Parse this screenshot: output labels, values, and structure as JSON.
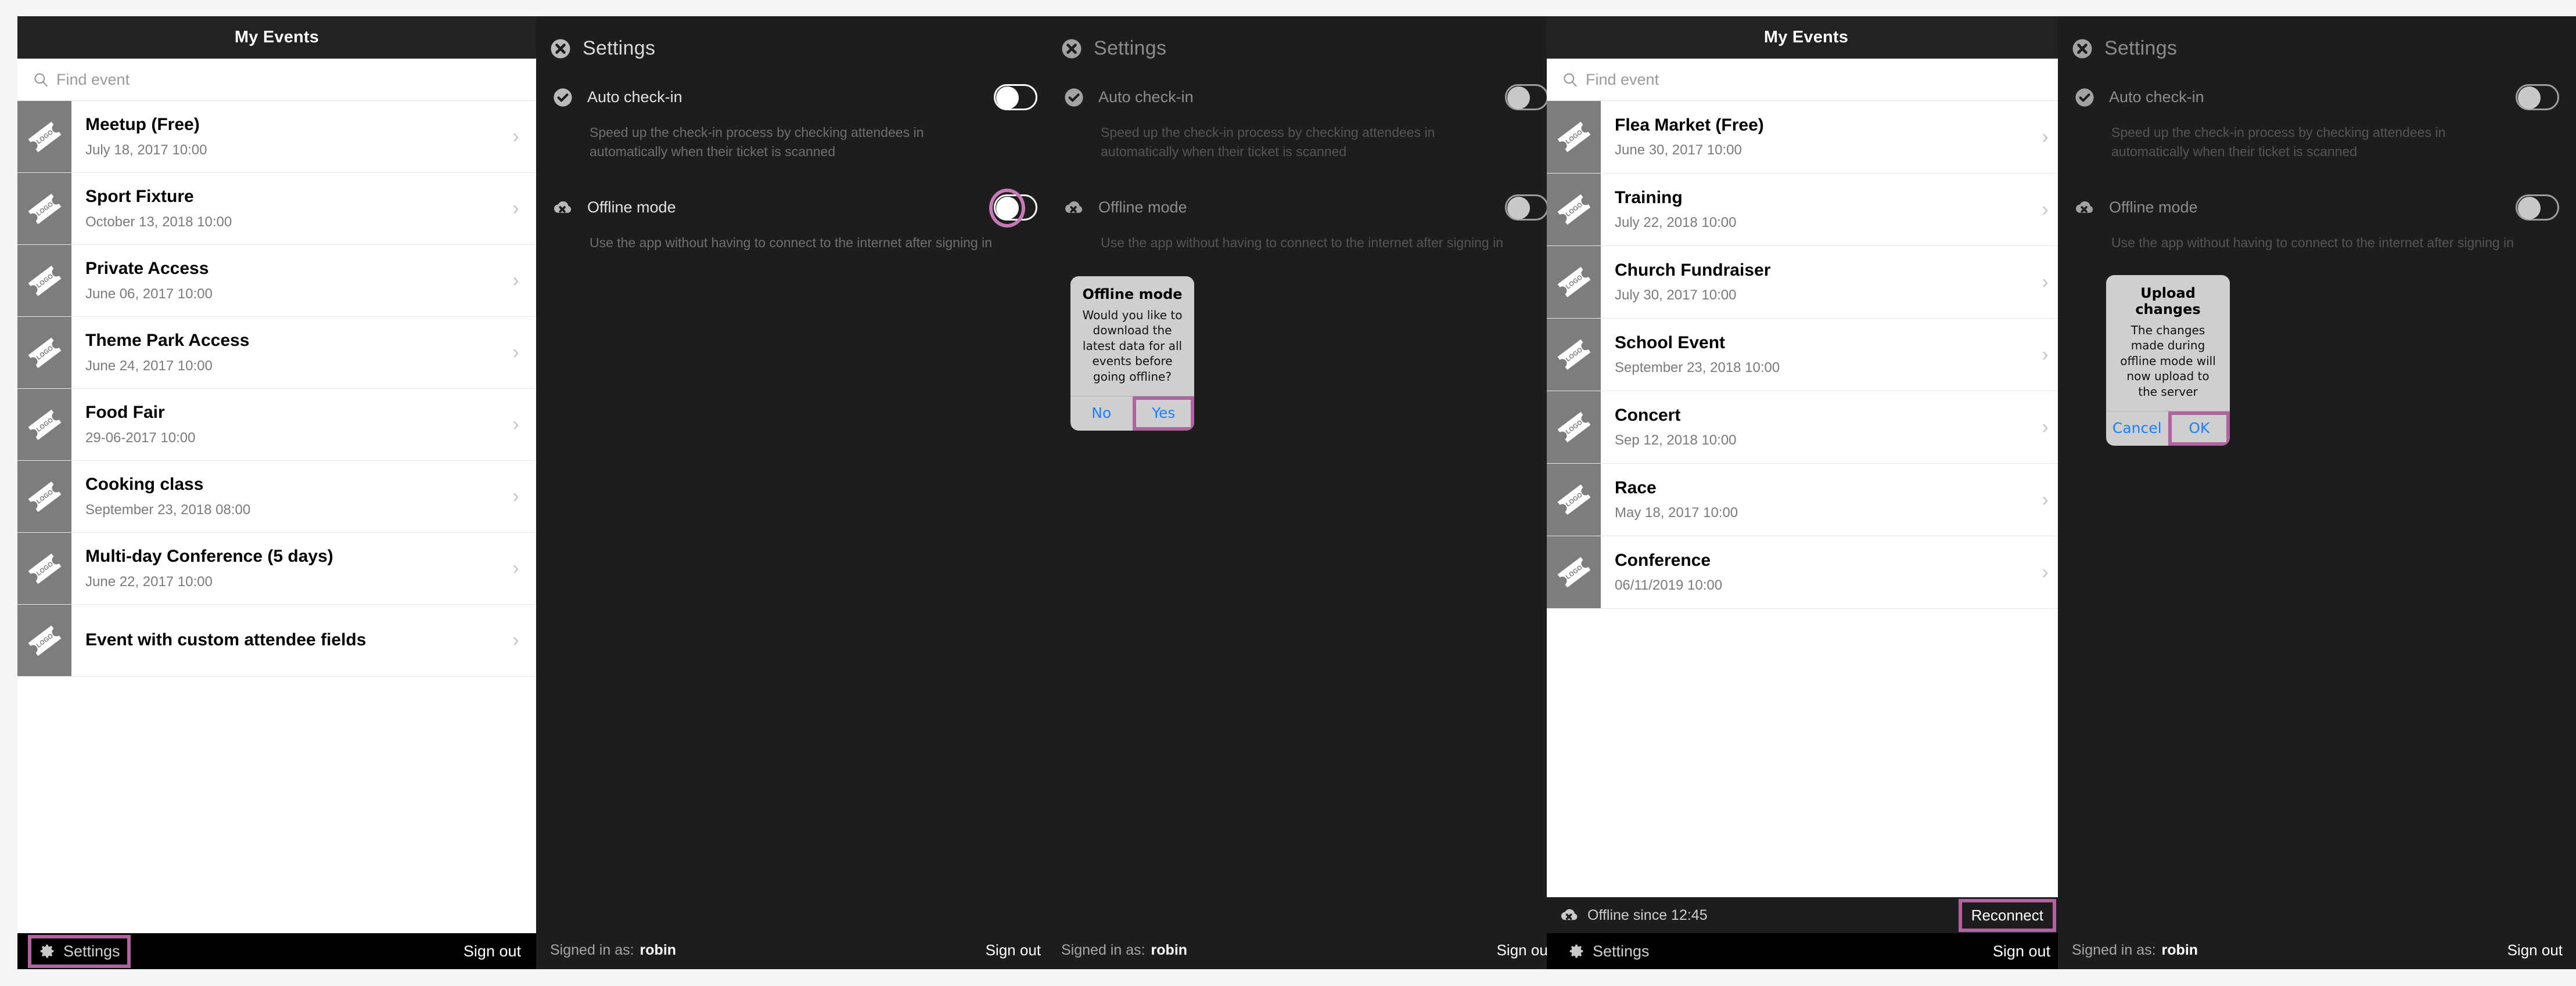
{
  "colors": {
    "highlight": "#b0639f",
    "dialog_action": "#1a7fff",
    "header_bg": "#222222",
    "panel_dark": "#1d1d1d",
    "thumb_bg": "#7d7d7d"
  },
  "panel1": {
    "header_title": "My Events",
    "search_placeholder": "Find event",
    "events": [
      {
        "title": "Meetup (Free)",
        "date": "July 18, 2017 10:00"
      },
      {
        "title": "Sport Fixture",
        "date": "October 13, 2018 10:00"
      },
      {
        "title": "Private Access",
        "date": "June 06, 2017 10:00"
      },
      {
        "title": "Theme Park Access",
        "date": "June 24, 2017 10:00"
      },
      {
        "title": "Food Fair",
        "date": "29-06-2017 10:00"
      },
      {
        "title": "Cooking class",
        "date": "September 23, 2018 08:00"
      },
      {
        "title": "Multi-day Conference (5 days)",
        "date": "June 22, 2017 10:00"
      },
      {
        "title": "Event with custom attendee fields",
        "date": ""
      }
    ],
    "settings_label": "Settings",
    "signout_label": "Sign out",
    "thumb_text": "LOGO"
  },
  "panel2": {
    "title": "Settings",
    "auto_checkin": {
      "label": "Auto check-in",
      "description": "Speed up the check-in process by checking attendees in automatically when their ticket is scanned",
      "state": "off"
    },
    "offline_mode": {
      "label": "Offline mode",
      "description": "Use the app without having to connect to the internet after signing in",
      "state": "off"
    },
    "signed_in_label": "Signed in as:",
    "signed_in_user": "robin",
    "signout_label": "Sign out"
  },
  "panel3": {
    "title": "Settings",
    "auto_checkin": {
      "label": "Auto check-in",
      "description": "Speed up the check-in process by checking attendees in automatically when their ticket is scanned",
      "state": "off"
    },
    "offline_mode": {
      "label": "Offline mode",
      "description": "Use the app without having to connect to the internet after signing in",
      "state": "off"
    },
    "dialog": {
      "title": "Offline mode",
      "message": "Would you like to download the latest data for all events before going offline?",
      "button_no": "No",
      "button_yes": "Yes"
    },
    "signed_in_label": "Signed in as:",
    "signed_in_user": "robin",
    "signout_label": "Sign out"
  },
  "panel4": {
    "header_title": "My Events",
    "search_placeholder": "Find event",
    "events": [
      {
        "title": "Flea Market (Free)",
        "date": "June 30, 2017 10:00"
      },
      {
        "title": "Training",
        "date": "July 22, 2018 10:00"
      },
      {
        "title": "Church Fundraiser",
        "date": "July 30, 2017 10:00"
      },
      {
        "title": "School Event",
        "date": "September 23, 2018 10:00"
      },
      {
        "title": "Concert",
        "date": "Sep 12, 2018 10:00"
      },
      {
        "title": "Race",
        "date": "May 18, 2017 10:00"
      },
      {
        "title": "Conference",
        "date": "06/11/2019 10:00"
      }
    ],
    "offline_status": "Offline since 12:45",
    "reconnect_label": "Reconnect",
    "settings_label": "Settings",
    "signout_label": "Sign out",
    "thumb_text": "LOGO"
  },
  "panel5": {
    "title": "Settings",
    "auto_checkin": {
      "label": "Auto check-in",
      "description": "Speed up the check-in process by checking attendees in automatically when their ticket is scanned",
      "state": "off"
    },
    "offline_mode": {
      "label": "Offline mode",
      "description": "Use the app without having to connect to the internet after signing in",
      "state": "off"
    },
    "dialog": {
      "title": "Upload changes",
      "message": "The changes made during offline mode will now upload to the server",
      "button_cancel": "Cancel",
      "button_ok": "OK"
    },
    "signed_in_label": "Signed in as:",
    "signed_in_user": "robin",
    "signout_label": "Sign out"
  }
}
